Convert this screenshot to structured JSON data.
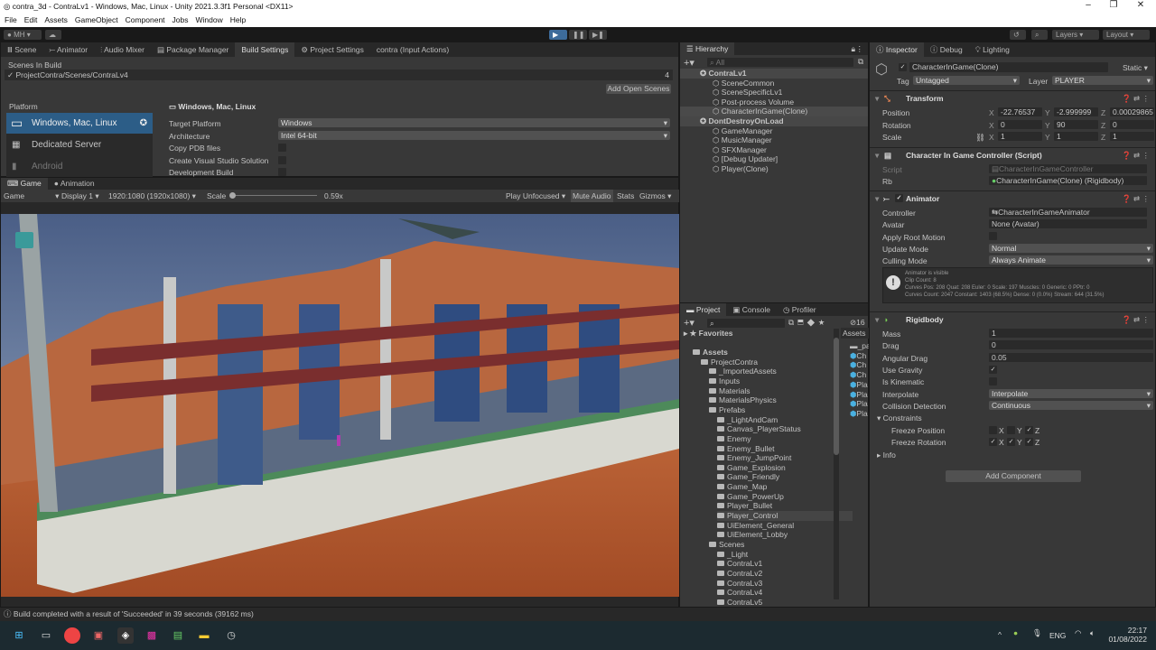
{
  "window": {
    "title": "contra_3d - ContraLv1 - Windows, Mac, Linux - Unity 2021.3.3f1 Personal <DX11>",
    "minimize": "–",
    "maximize": "❐",
    "close": "✕"
  },
  "menu": [
    "File",
    "Edit",
    "Assets",
    "GameObject",
    "Component",
    "Jobs",
    "Window",
    "Help"
  ],
  "toolbar": {
    "account": "MH",
    "layers": "Layers",
    "layout": "Layout"
  },
  "top_tabs": [
    "Scene",
    "Animator",
    "Audio Mixer",
    "Package Manager",
    "Build Settings",
    "Project Settings",
    "contra (Input Actions)"
  ],
  "build": {
    "scenes_label": "Scenes In Build",
    "scene": "ProjectContra/Scenes/ContraLv4",
    "scene_index": "4",
    "add_open": "Add Open Scenes",
    "platform_label": "Platform",
    "platforms": [
      "Windows, Mac, Linux",
      "Dedicated Server",
      "Android"
    ],
    "platform_title": "Windows, Mac, Linux",
    "target_platform_label": "Target Platform",
    "target_platform": "Windows",
    "arch_label": "Architecture",
    "arch": "Intel 64-bit",
    "copy_pdb": "Copy PDB files",
    "create_vs": "Create Visual Studio Solution",
    "dev_build": "Development Build"
  },
  "game": {
    "tabs": [
      "Game",
      "Animation"
    ],
    "mode": "Game",
    "display": "Display 1",
    "resolution": "1920:1080 (1920x1080)",
    "scale_label": "Scale",
    "scale": "0.59x",
    "play_unfocused": "Play Unfocused",
    "mute": "Mute Audio",
    "stats": "Stats",
    "gizmos": "Gizmos",
    "scale_fraction": 0.0
  },
  "status": "Build completed with a result of 'Succeeded' in 39 seconds (39162 ms)",
  "hierarchy": {
    "title": "Hierarchy",
    "search": "All",
    "items": [
      {
        "name": "ContraLv1",
        "depth": 0,
        "scene": true
      },
      {
        "name": "SceneCommon",
        "depth": 1
      },
      {
        "name": "SceneSpecificLv1",
        "depth": 1
      },
      {
        "name": "Post-process Volume",
        "depth": 1
      },
      {
        "name": "CharacterInGame(Clone)",
        "depth": 1,
        "selected": true
      },
      {
        "name": "DontDestroyOnLoad",
        "depth": 0,
        "scene": true
      },
      {
        "name": "GameManager",
        "depth": 1
      },
      {
        "name": "MusicManager",
        "depth": 1
      },
      {
        "name": "SFXManager",
        "depth": 1
      },
      {
        "name": "[Debug Updater]",
        "depth": 1
      },
      {
        "name": "Player(Clone)",
        "depth": 1
      }
    ]
  },
  "project": {
    "tabs": [
      "Project",
      "Console",
      "Profiler"
    ],
    "hidden_count": "16",
    "favorites": "Favorites",
    "assets_header": "Assets",
    "tree": [
      {
        "name": "Assets",
        "depth": 0
      },
      {
        "name": "ProjectContra",
        "depth": 1
      },
      {
        "name": "_ImportedAssets",
        "depth": 2
      },
      {
        "name": "Inputs",
        "depth": 2
      },
      {
        "name": "Materials",
        "depth": 2
      },
      {
        "name": "MaterialsPhysics",
        "depth": 2
      },
      {
        "name": "Prefabs",
        "depth": 2
      },
      {
        "name": "_LightAndCam",
        "depth": 3
      },
      {
        "name": "Canvas_PlayerStatus",
        "depth": 3
      },
      {
        "name": "Enemy",
        "depth": 3
      },
      {
        "name": "Enemy_Bullet",
        "depth": 3
      },
      {
        "name": "Enemy_JumpPoint",
        "depth": 3
      },
      {
        "name": "Game_Explosion",
        "depth": 3
      },
      {
        "name": "Game_Friendly",
        "depth": 3
      },
      {
        "name": "Game_Map",
        "depth": 3
      },
      {
        "name": "Game_PowerUp",
        "depth": 3
      },
      {
        "name": "Player_Bullet",
        "depth": 3
      },
      {
        "name": "Player_Control",
        "depth": 3
      },
      {
        "name": "UiElement_General",
        "depth": 3
      },
      {
        "name": "UiElement_Lobby",
        "depth": 3
      },
      {
        "name": "Scenes",
        "depth": 2
      },
      {
        "name": "_Light",
        "depth": 3
      },
      {
        "name": "ContraLv1",
        "depth": 3
      },
      {
        "name": "ContraLv2",
        "depth": 3
      },
      {
        "name": "ContraLv3",
        "depth": 3
      },
      {
        "name": "ContraLv4",
        "depth": 3
      },
      {
        "name": "ContraLv5",
        "depth": 3
      }
    ],
    "right": [
      "_pa",
      "Ch",
      "Ch",
      "Ch",
      "Pla",
      "Pla",
      "Pla",
      "Pla"
    ]
  },
  "inspector": {
    "tabs": [
      "Inspector",
      "Debug",
      "Lighting"
    ],
    "object": "CharacterInGame(Clone)",
    "static": "Static",
    "tag_label": "Tag",
    "tag": "Untagged",
    "layer_label": "Layer",
    "layer": "PLAYER",
    "transform": {
      "title": "Transform",
      "rows": [
        {
          "label": "Position",
          "x": "-22.76537",
          "y": "-2.999999",
          "z": "0.00029865"
        },
        {
          "label": "Rotation",
          "x": "0",
          "y": "90",
          "z": "0"
        },
        {
          "label": "Scale",
          "x": "1",
          "y": "1",
          "z": "1"
        }
      ]
    },
    "script": {
      "title": "Character In Game Controller (Script)",
      "script_label": "Script",
      "script": "CharacterInGameController",
      "rb_label": "Rb",
      "rb": "CharacterInGame(Clone) (Rigidbody)"
    },
    "animator": {
      "title": "Animator",
      "controller_label": "Controller",
      "controller": "CharacterInGameAnimator",
      "avatar_label": "Avatar",
      "avatar": "None (Avatar)",
      "root_motion": "Apply Root Motion",
      "update_label": "Update Mode",
      "update": "Normal",
      "culling_label": "Culling Mode",
      "culling": "Always Animate",
      "info": [
        "Animator is visible",
        "Clip Count: 8",
        "Curves Pos: 208 Quat: 208 Euler: 0 Scale: 197 Muscles: 0 Generic: 0 PPtr: 0",
        "Curves Count: 2047 Constant: 1403 (68.5%) Dense: 0 (0.0%) Stream: 644 (31.5%)"
      ]
    },
    "rigidbody": {
      "title": "Rigidbody",
      "mass_label": "Mass",
      "mass": "1",
      "drag_label": "Drag",
      "drag": "0",
      "adrag_label": "Angular Drag",
      "adrag": "0.05",
      "gravity_label": "Use Gravity",
      "kinematic_label": "Is Kinematic",
      "interp_label": "Interpolate",
      "interp": "Interpolate",
      "coll_label": "Collision Detection",
      "coll": "Continuous",
      "constraints": "Constraints",
      "freeze_pos": "Freeze Position",
      "freeze_rot": "Freeze Rotation",
      "info": "Info",
      "x": "X",
      "y": "Y",
      "z": "Z"
    },
    "add_component": "Add Component"
  },
  "taskbar": {
    "lang": "ENG",
    "time": "22:17",
    "date": "01/08/2022"
  }
}
